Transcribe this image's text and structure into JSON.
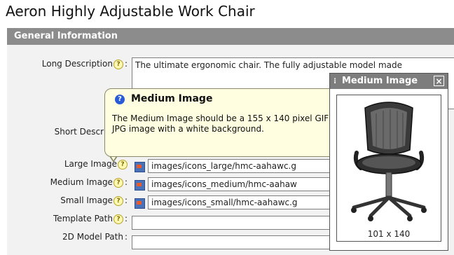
{
  "page": {
    "title": "Aeron Highly Adjustable Work Chair"
  },
  "section": {
    "title": "General Information"
  },
  "form": {
    "help_glyph": "?",
    "colon": ":",
    "long_description": {
      "label": "Long Description",
      "value": "The ultimate ergonomic chair. The fully adjustable model made"
    },
    "short_description": {
      "label": "Short Description"
    },
    "large_image": {
      "label": "Large Image",
      "value": "images/icons_large/hmc-aahawc.g"
    },
    "medium_image": {
      "label": "Medium Image",
      "value": "images/icons_medium/hmc-aahaw"
    },
    "small_image": {
      "label": "Small Image",
      "value": "images/icons_small/hmc-aahawc.g"
    },
    "template_path": {
      "label": "Template Path",
      "value": ""
    },
    "model_path": {
      "label": "2D Model Path",
      "value": ""
    }
  },
  "tooltip": {
    "icon": "info-icon",
    "title": "Medium Image",
    "close": "×",
    "body": "The Medium Image should be a 155 x 140 pixel GIF or JPG image with a white background."
  },
  "preview": {
    "grip": "⁝",
    "title": "Medium Image",
    "close": "×",
    "dimensions": "101 x 140"
  }
}
